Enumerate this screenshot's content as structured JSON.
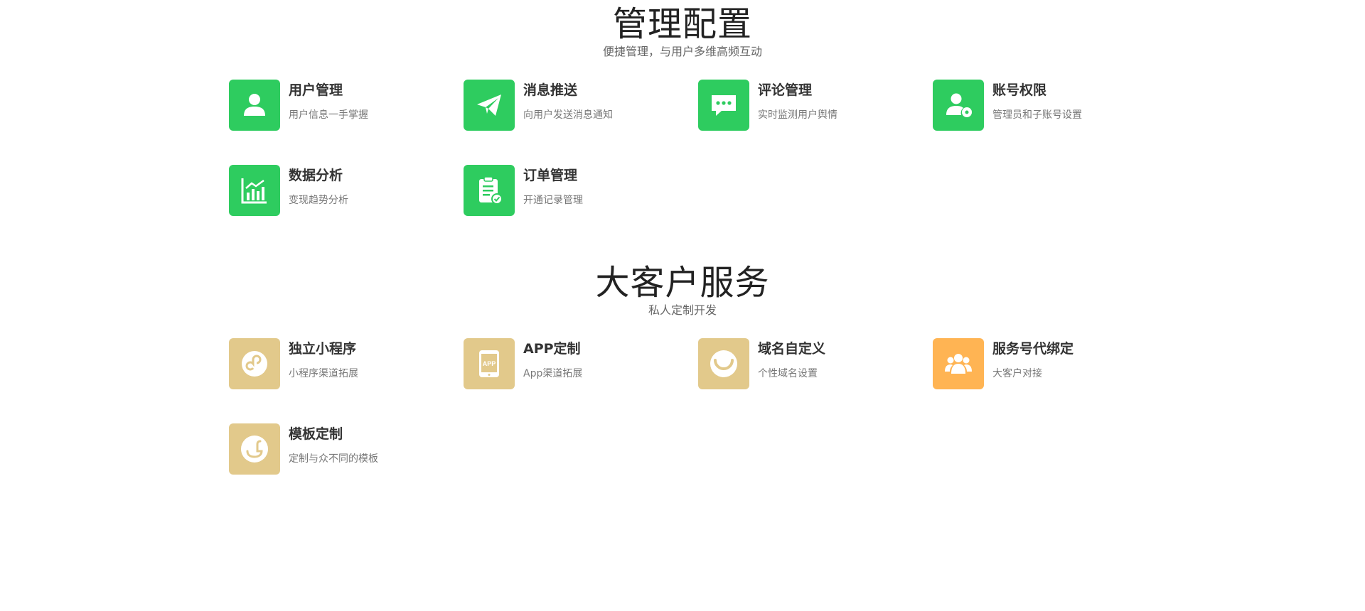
{
  "sections": [
    {
      "title": "管理配置",
      "subtitle": "便捷管理，与用户多维高频互动",
      "items": [
        {
          "title": "用户管理",
          "desc": "用户信息一手掌握",
          "icon": "user-icon",
          "color": "#2ecc5f"
        },
        {
          "title": "消息推送",
          "desc": "向用户发送消息通知",
          "icon": "paper-plane-icon",
          "color": "#2ecc5f"
        },
        {
          "title": "评论管理",
          "desc": "实时监测用户舆情",
          "icon": "chat-bubble-icon",
          "color": "#2ecc5f"
        },
        {
          "title": "账号权限",
          "desc": "管理员和子账号设置",
          "icon": "user-settings-icon",
          "color": "#2ecc5f"
        },
        {
          "title": "数据分析",
          "desc": "变现趋势分析",
          "icon": "bar-chart-icon",
          "color": "#2ecc5f"
        },
        {
          "title": "订单管理",
          "desc": "开通记录管理",
          "icon": "clipboard-check-icon",
          "color": "#2ecc5f"
        }
      ]
    },
    {
      "title": "大客户服务",
      "subtitle": "私人定制开发",
      "items": [
        {
          "title": "独立小程序",
          "desc": "小程序渠道拓展",
          "icon": "mini-program-icon",
          "color": "#e2c98b"
        },
        {
          "title": "APP定制",
          "desc": "App渠道拓展",
          "icon": "app-phone-icon",
          "color": "#e2c98b",
          "icon_text": "APP"
        },
        {
          "title": "域名自定义",
          "desc": "个性域名设置",
          "icon": "smile-icon",
          "color": "#e2c98b"
        },
        {
          "title": "服务号代绑定",
          "desc": "大客户对接",
          "icon": "group-users-icon",
          "color": "#ffb453"
        },
        {
          "title": "模板定制",
          "desc": "定制与众不同的模板",
          "icon": "duck-icon",
          "color": "#e2c98b"
        }
      ]
    }
  ]
}
